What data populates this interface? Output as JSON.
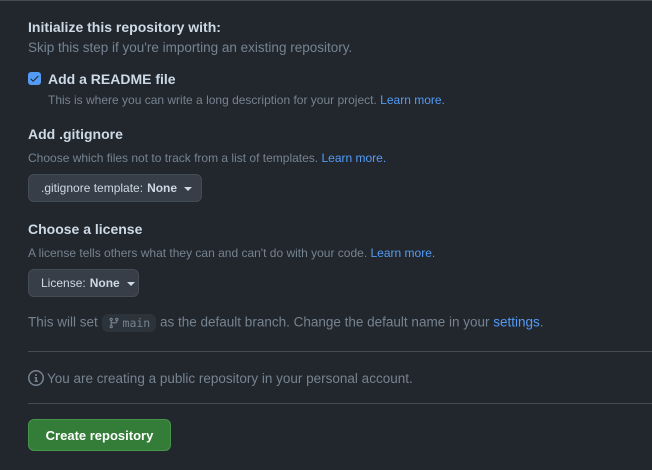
{
  "init": {
    "heading": "Initialize this repository with:",
    "subheading": "Skip this step if you're importing an existing repository."
  },
  "readme": {
    "checked": true,
    "label": "Add a README file",
    "description": "This is where you can write a long description for your project.",
    "learn_more": "Learn more."
  },
  "gitignore": {
    "heading": "Add .gitignore",
    "description": "Choose which files not to track from a list of templates.",
    "learn_more": "Learn more.",
    "select_label": ".gitignore template:",
    "select_value": "None"
  },
  "license": {
    "heading": "Choose a license",
    "description": "A license tells others what they can and can't do with your code.",
    "learn_more": "Learn more.",
    "select_label": "License:",
    "select_value": "None"
  },
  "branch": {
    "prefix": "This will set",
    "name": "main",
    "middle": "as the default branch. Change the default name in your",
    "settings_link": "settings",
    "suffix": "."
  },
  "visibility_notice": "You are creating a public repository in your personal account.",
  "create_button": "Create repository",
  "colors": {
    "background": "#22272e",
    "link": "#539bf5",
    "primary_button": "#347d39"
  }
}
